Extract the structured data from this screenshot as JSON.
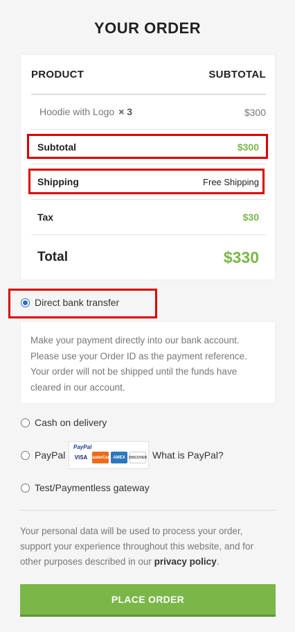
{
  "page_title": "YOUR ORDER",
  "table": {
    "col_product": "PRODUCT",
    "col_subtotal": "SUBTOTAL",
    "item": {
      "name": "Hoodie with Logo",
      "qty": "× 3",
      "price": "$300"
    },
    "subtotal": {
      "label": "Subtotal",
      "value": "$300"
    },
    "shipping": {
      "label": "Shipping",
      "value": "Free Shipping"
    },
    "tax": {
      "label": "Tax",
      "value": "$30"
    },
    "total": {
      "label": "Total",
      "value": "$330"
    }
  },
  "payment": {
    "bank_transfer": {
      "label": "Direct bank transfer",
      "selected": true,
      "description": "Make your payment directly into our bank account. Please use your Order ID as the payment reference. Your order will not be shipped until the funds have cleared in our account."
    },
    "cod": {
      "label": "Cash on delivery",
      "selected": false
    },
    "paypal": {
      "label": "PayPal",
      "selected": false,
      "logo_text": "PayPal",
      "cards": [
        "VISA",
        "MasterCard",
        "AMEX",
        "DISCOVER"
      ],
      "what_is_link": "What is PayPal?"
    },
    "test_gateway": {
      "label": "Test/Paymentless gateway",
      "selected": false
    }
  },
  "privacy": {
    "text": "Your personal data will be used to process your order, support your experience throughout this website, and for other purposes described in our",
    "link": "privacy policy",
    "end": "."
  },
  "place_order_label": "PLACE ORDER",
  "colors": {
    "accent_green": "#7ab648",
    "highlight_red": "#dc0000",
    "radio_blue": "#2b6cc4"
  }
}
